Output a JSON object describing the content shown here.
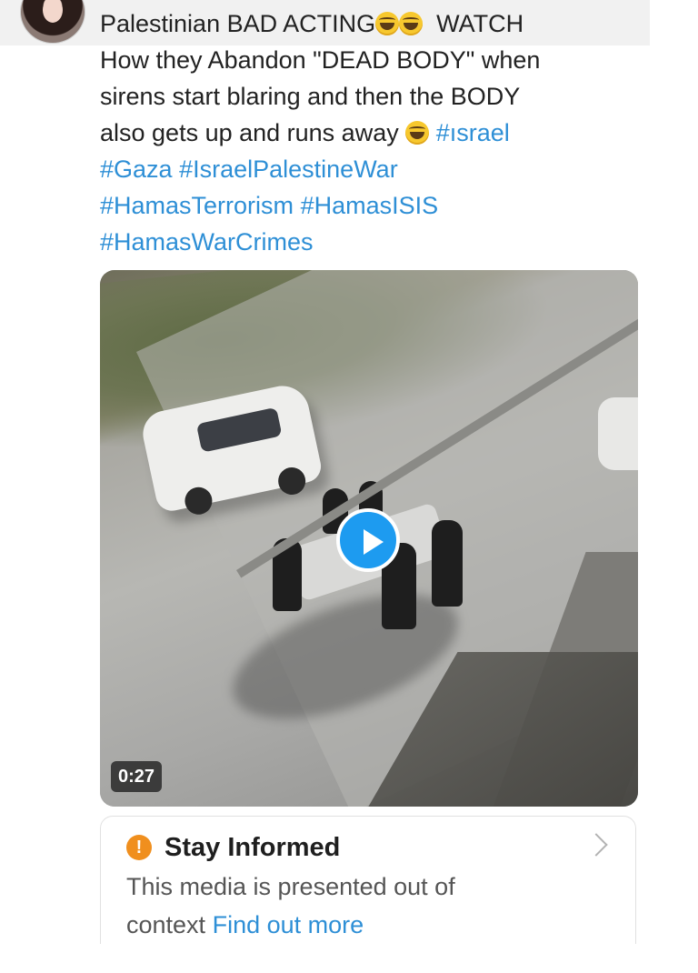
{
  "post": {
    "text_lines": [
      "Palestinian BAD ACTING",
      "How they Abandon \"DEAD BODY\" when",
      "sirens start blaring and then the BODY",
      "also gets up and runs away"
    ],
    "watch_label": "WATCH",
    "hashtags": {
      "israel": "#ısrael",
      "gaza": "#Gaza",
      "israel_palestine_war": "#IsraelPalestineWar",
      "hamas_terrorism": "#HamasTerrorism",
      "hamas_isis": "#HamasISIS",
      "hamas_war_crimes": "#HamasWarCrimes"
    },
    "emoji": "laughing-face-emoji"
  },
  "media": {
    "duration": "0:27",
    "play_icon": "play-icon"
  },
  "notice": {
    "icon": "exclamation-icon",
    "title": "Stay Informed",
    "body": "This media is presented out of",
    "body_line2": "context",
    "link_label": "Find out more",
    "chevron_icon": "chevron-right-icon"
  },
  "colors": {
    "hashtag": "#2e8fd6",
    "play_button": "#1d9bf0",
    "warning": "#f08f1e"
  }
}
